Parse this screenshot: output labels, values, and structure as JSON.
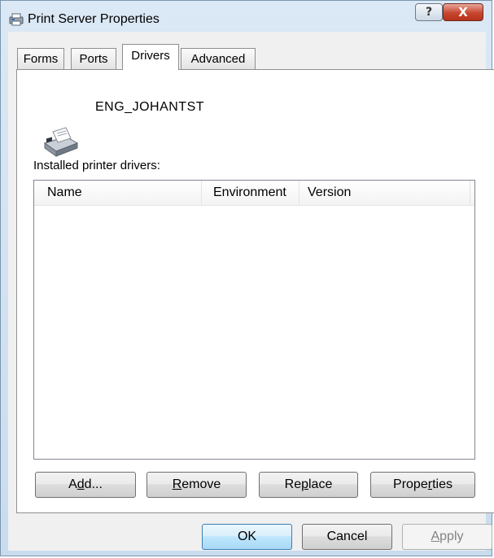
{
  "window": {
    "title": "Print Server Properties",
    "help_label": "?",
    "close_label": "X"
  },
  "tabs": [
    {
      "label": "Forms",
      "selected": false
    },
    {
      "label": "Ports",
      "selected": false
    },
    {
      "label": "Drivers",
      "selected": true
    },
    {
      "label": "Advanced",
      "selected": false
    }
  ],
  "drivers_page": {
    "server_name": "ENG_JOHANTST",
    "installed_label": "Installed printer drivers:",
    "columns": [
      "Name",
      "Environment",
      "Version"
    ],
    "rows": []
  },
  "buttons": {
    "add": {
      "pre": "A",
      "key": "d",
      "post": "d..."
    },
    "remove": {
      "pre": "",
      "key": "R",
      "post": "emove"
    },
    "replace": {
      "pre": "Re",
      "key": "p",
      "post": "lace"
    },
    "properties": {
      "pre": "Prope",
      "key": "r",
      "post": "ties"
    },
    "ok": "OK",
    "cancel": "Cancel",
    "apply": {
      "pre": "",
      "key": "A",
      "post": "pply"
    }
  },
  "colors": {
    "titlebar": "#c9dcee",
    "close": "#c8462f",
    "ok_border": "#3c7fb1"
  },
  "icons": {
    "title": "print-server-icon",
    "server": "fax-printer-icon"
  }
}
